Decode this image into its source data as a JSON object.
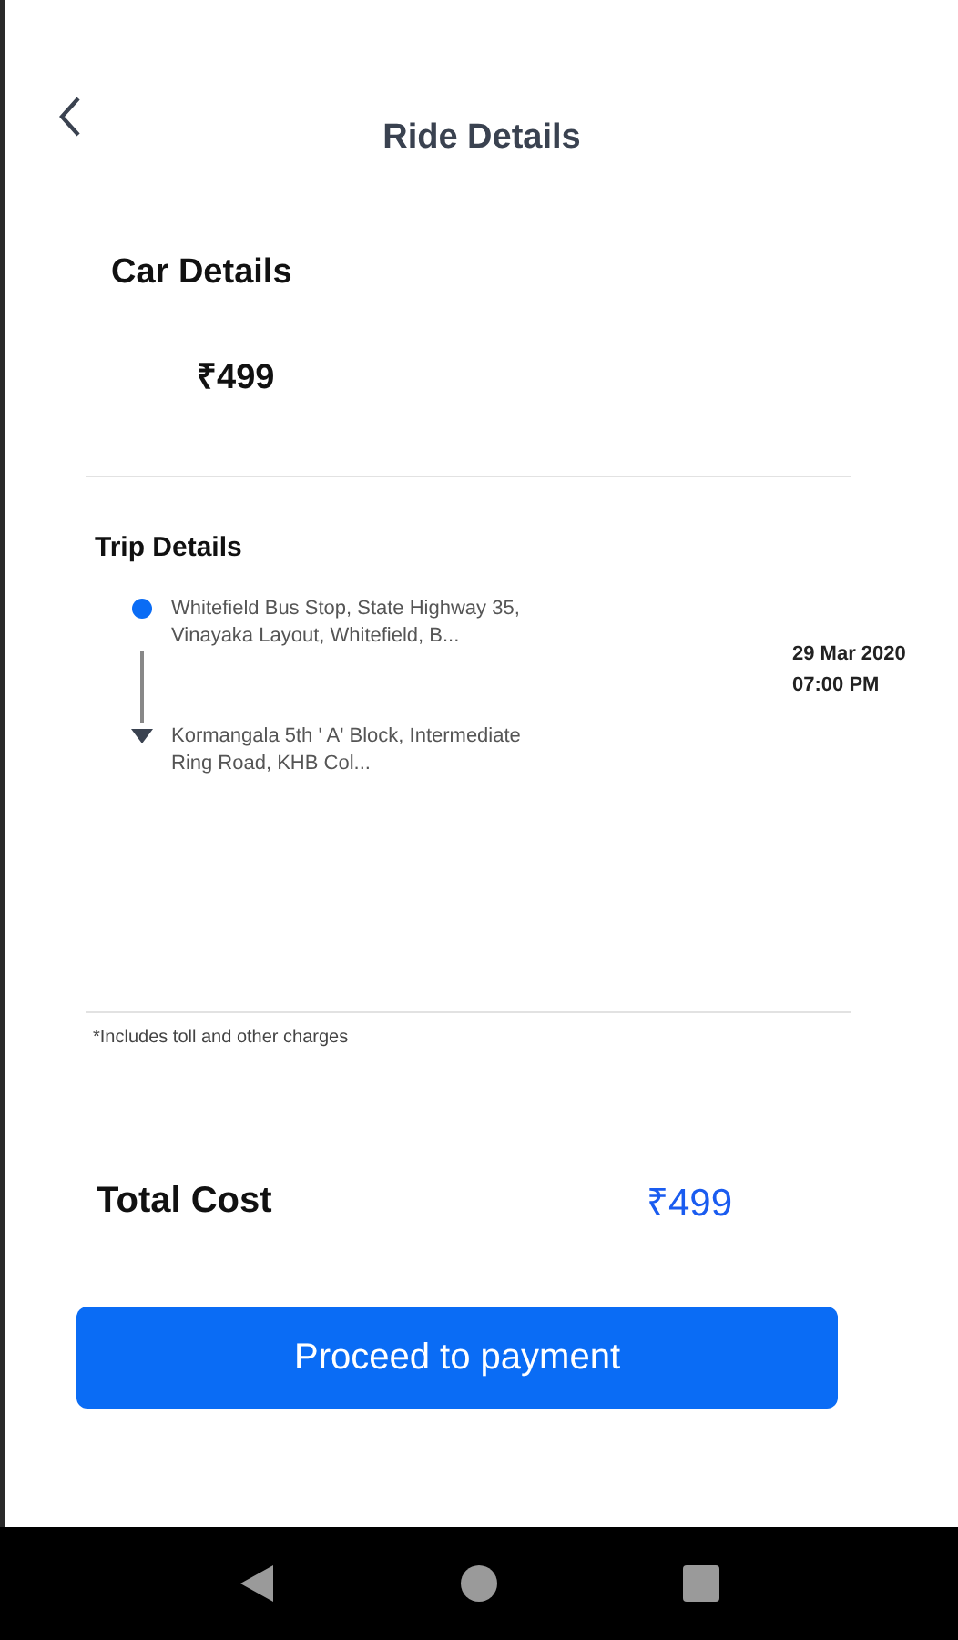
{
  "header": {
    "title": "Ride Details"
  },
  "car_details": {
    "heading": "Car Details",
    "price": "₹499"
  },
  "trip_details": {
    "heading": "Trip Details",
    "stops": [
      {
        "kind": "pickup",
        "address": "Whitefield Bus Stop, State Highway 35, Vinayaka Layout, Whitefield, B..."
      },
      {
        "kind": "drop",
        "address": "Kormangala 5th ' A' Block, Intermediate Ring Road, KHB Col..."
      }
    ],
    "date": "29 Mar 2020",
    "time": "07:00 PM"
  },
  "note": "*Includes toll and other charges",
  "total": {
    "label": "Total Cost",
    "amount": "₹499"
  },
  "buttons": [
    "Proceed to payment"
  ]
}
